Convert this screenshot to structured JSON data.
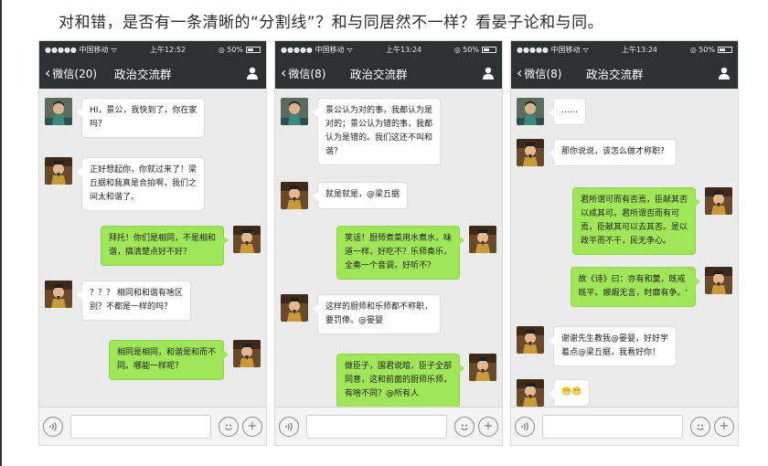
{
  "headline": "对和错，是否有一条清晰的“分割线”？和与同居然不一样？看晏子论和与同。",
  "phones": [
    {
      "status": {
        "carrier": "●●●●● 中国移动 ᯤ",
        "time": "上午12:52",
        "battery": "◎ 50%"
      },
      "back_label": "微信(20)",
      "title": "政治交流群",
      "messages": [
        {
          "side": "left",
          "avatar": "yanzi",
          "text": [
            "HI，景公，我快到了，你在家",
            "吗？"
          ]
        },
        {
          "side": "left",
          "avatar": "jinggong",
          "text": [
            "正好想起你，你就过来了！梁",
            "丘据和我真是合拍啊，我们之",
            "间太和谐了。"
          ]
        },
        {
          "side": "right",
          "avatar": "jinggong",
          "text": [
            "拜托！你们是相同，不是相和",
            "谐，搞清楚点好不好？"
          ]
        },
        {
          "side": "left",
          "avatar": "jinggong",
          "text": [
            "？？？ 相同和和谐有啥区",
            "别？不都是一样的吗？"
          ]
        },
        {
          "side": "right",
          "avatar": "jinggong",
          "text": [
            "相同是相同，和谐是和而不",
            "同。哪能一样呢？"
          ]
        }
      ]
    },
    {
      "status": {
        "carrier": "●●●●● 中国移动 ᯤ",
        "time": "上午13:24",
        "battery": "◎ 50%"
      },
      "back_label": "微信(8)",
      "title": "政治交流群",
      "messages": [
        {
          "side": "left",
          "avatar": "yanzi",
          "text": [
            "景公认为对的事，我都认为是",
            "对的；景公认为错的事，我都",
            "认为是错的。我们这还不叫和",
            "谐？"
          ]
        },
        {
          "side": "left",
          "avatar": "jinggong",
          "text": [
            "就是就是，@梁丘据"
          ]
        },
        {
          "side": "right",
          "avatar": "jinggong",
          "text": [
            "笑话！厨师煮菜用水煮水，味",
            "道一样，好吃不？乐师奏乐，",
            "全奏一个音调，好听不？"
          ]
        },
        {
          "side": "left",
          "avatar": "jinggong",
          "text": [
            "这样的厨师和乐师都不称职，",
            "要罚俸。@晏婴"
          ]
        },
        {
          "side": "right",
          "avatar": "jinggong",
          "text": [
            "做臣子，国君说暗，臣子全部",
            "同意，这和前面的厨师乐师，",
            "有啥不同？@所有人"
          ]
        }
      ]
    },
    {
      "status": {
        "carrier": "●●●●● 中国移动 ᯤ",
        "time": "上午13:24",
        "battery": "◎ 50%"
      },
      "back_label": "微信(8)",
      "title": "政治交流群",
      "messages": [
        {
          "side": "left",
          "avatar": "yanzi",
          "text": [
            "……"
          ]
        },
        {
          "side": "left",
          "avatar": "jinggong",
          "text": [
            "那你说说，该怎么做才称职？"
          ]
        },
        {
          "side": "right",
          "avatar": "jinggong",
          "text": [
            "君所谓可而有否焉，臣献其否",
            "以成其可。君所谓否而有可",
            "焉，臣献其可以去其否。是以",
            "政平而不干，民无争心。"
          ]
        },
        {
          "side": "right",
          "avatar": "jinggong",
          "text": [
            "故《诗》曰：亦有和羹，既戒",
            "既平。鬷嘏无言，时靡有争。'"
          ]
        },
        {
          "side": "left",
          "avatar": "jinggong",
          "text": [
            "谢谢先生教我@晏婴，好好学",
            "着点@梁丘据，我看好你！"
          ]
        },
        {
          "side": "left",
          "avatar": "jinggong",
          "text": [
            "😬😬"
          ]
        }
      ]
    }
  ],
  "icons": {
    "back": "chevron-left-icon",
    "contact": "person-icon",
    "voice": "voice-icon",
    "emoji": "emoji-icon",
    "plus": "plus-icon"
  },
  "colors": {
    "nav": "#2e3132",
    "chat_bg": "#ebebeb",
    "green_bubble": "#9fe658",
    "white_bubble": "#ffffff"
  }
}
